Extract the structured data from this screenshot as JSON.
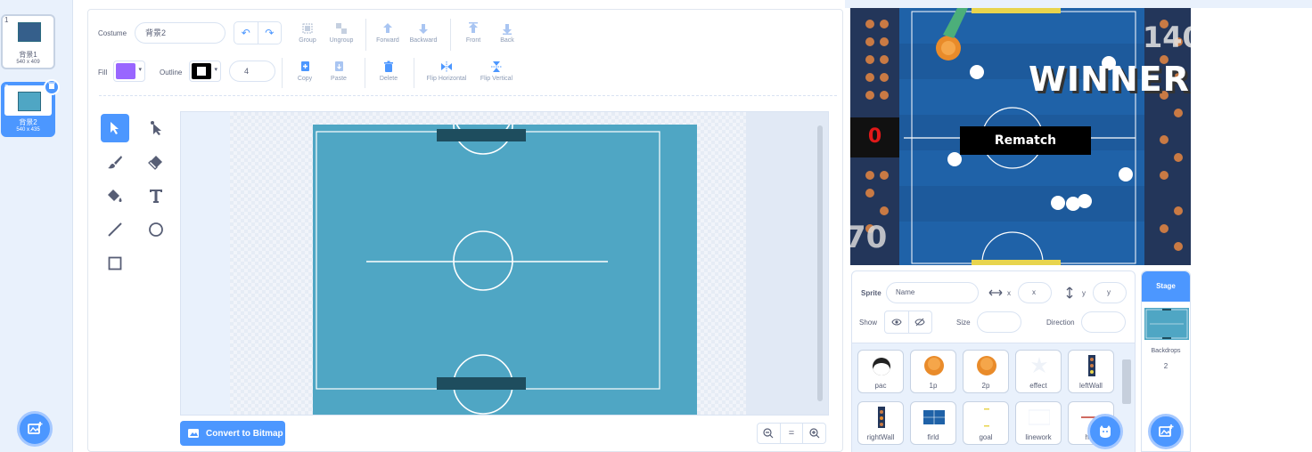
{
  "costumes": [
    {
      "num": "1",
      "name": "背景1",
      "size": "540 x 409"
    },
    {
      "num": "2",
      "name": "背景2",
      "size": "540 x 435"
    }
  ],
  "toolbar": {
    "costume_label": "Costume",
    "costume_name": "背景2",
    "group": "Group",
    "ungroup": "Ungroup",
    "forward": "Forward",
    "backward": "Backward",
    "front": "Front",
    "back": "Back",
    "fill_label": "Fill",
    "outline_label": "Outline",
    "outline_width": "4",
    "copy": "Copy",
    "paste": "Paste",
    "delete": "Delete",
    "flip_h": "Flip Horizontal",
    "flip_v": "Flip Vertical",
    "fill_color": "#9966ff",
    "outline_color": "#000000"
  },
  "convert_button": "Convert to Bitmap",
  "zoom": {
    "out": "−",
    "reset": "=",
    "in": "+"
  },
  "stage": {
    "left_score": "0",
    "right_score_top": "140",
    "bottom_left_score": "70",
    "winner": "WINNER",
    "rematch": "Rematch"
  },
  "sprite_info": {
    "sprite_label": "Sprite",
    "name_placeholder": "Name",
    "x_label": "x",
    "x_placeholder": "x",
    "y_label": "y",
    "y_placeholder": "y",
    "show_label": "Show",
    "size_label": "Size",
    "direction_label": "Direction"
  },
  "sprites": [
    "pac",
    "1p",
    "2p",
    "effect",
    "leftWall",
    "rightWall",
    "firld",
    "goal",
    "linework",
    "han"
  ],
  "stage_panel": {
    "tab": "Stage",
    "backdrops_label": "Backdrops",
    "backdrops_count": "2"
  }
}
